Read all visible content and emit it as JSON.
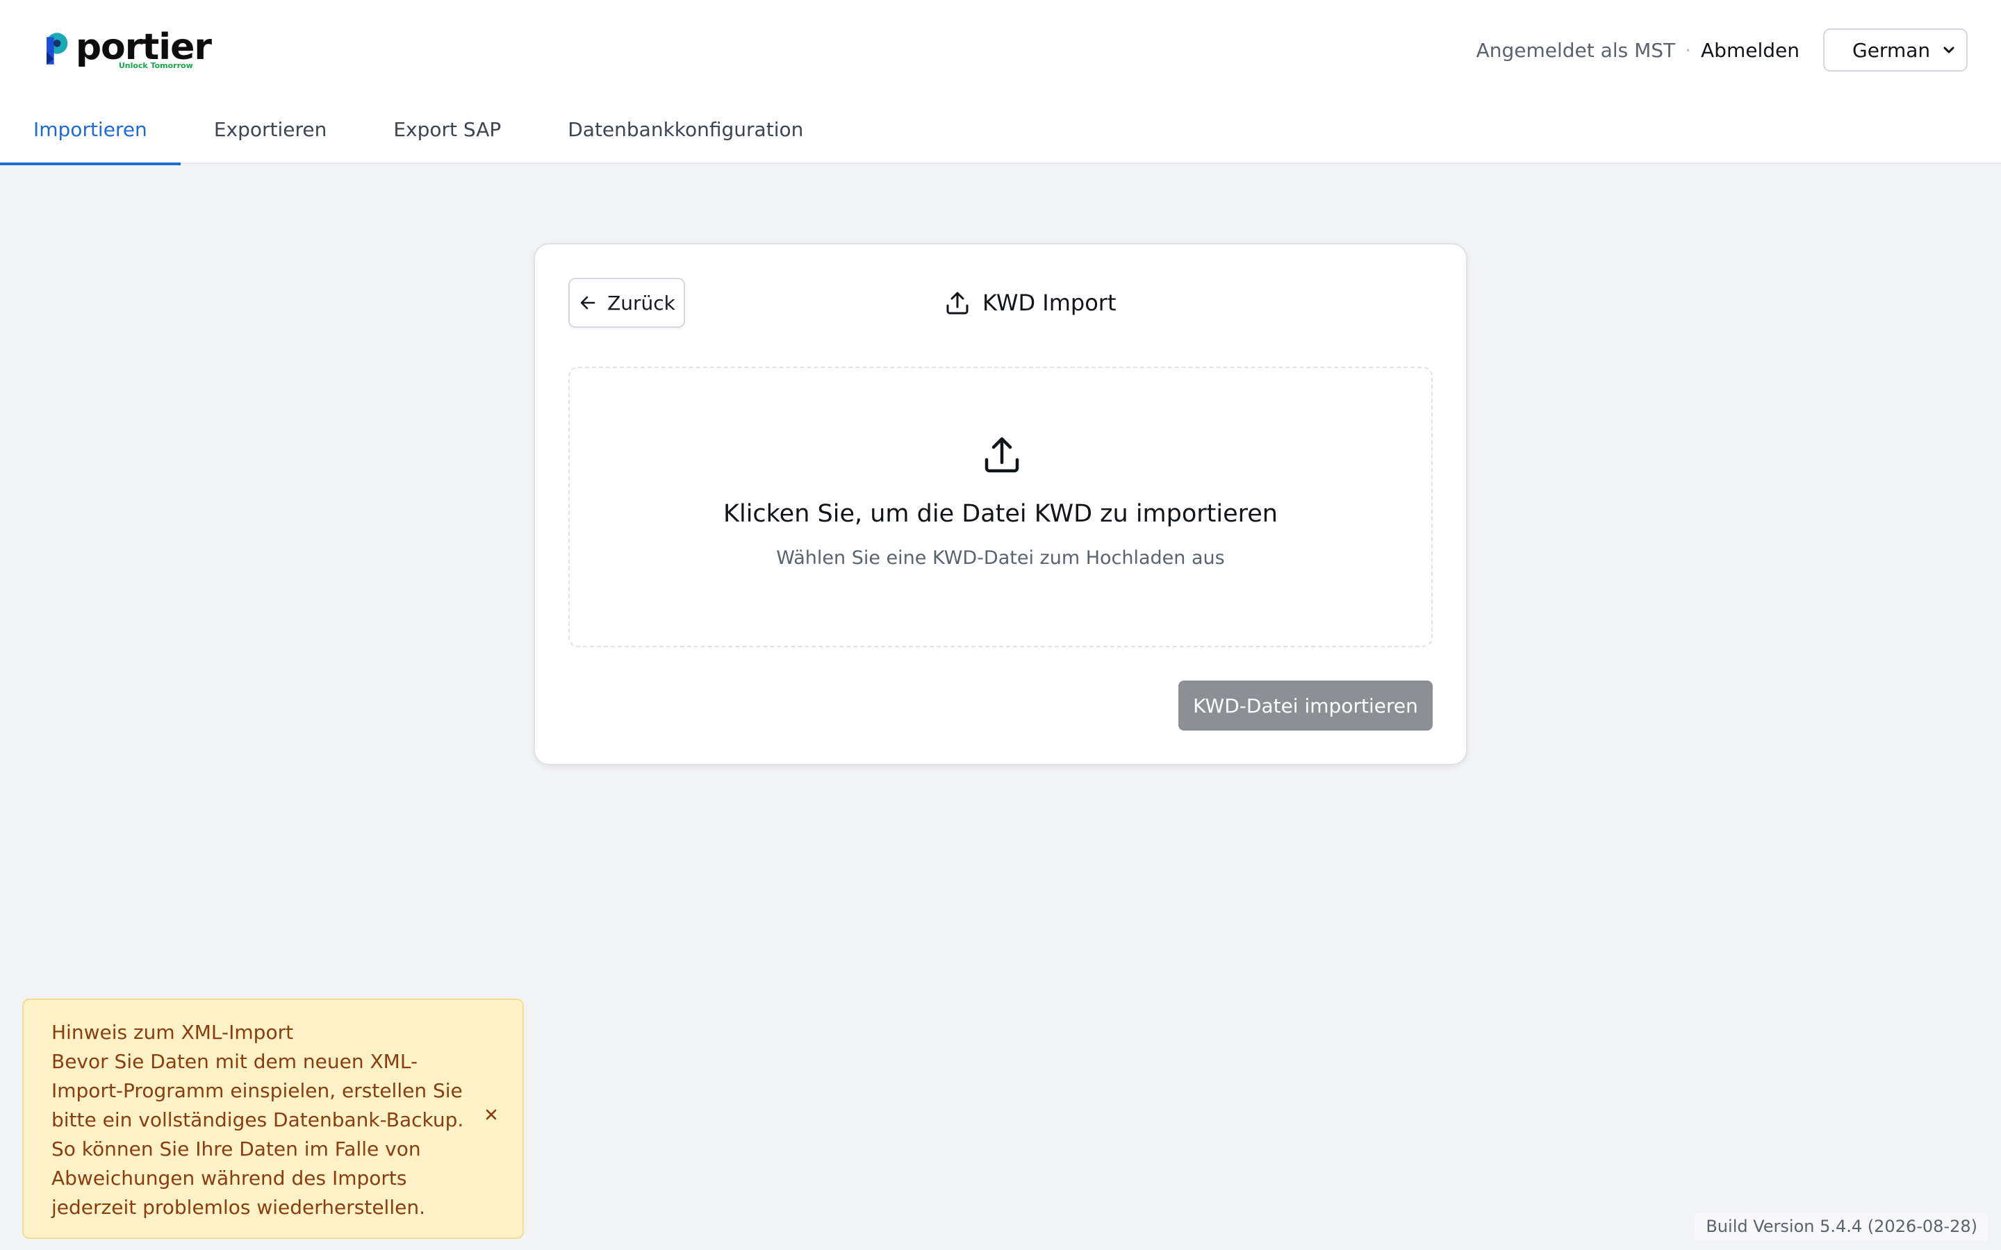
{
  "header": {
    "logo_text": "portier",
    "logo_tagline": "Unlock Tomorrow",
    "signed_in_text": "Angemeldet als MST",
    "separator": "·",
    "logout_label": "Abmelden",
    "language_selected": "German"
  },
  "nav": {
    "tabs": [
      {
        "label": "Importieren",
        "active": true
      },
      {
        "label": "Exportieren",
        "active": false
      },
      {
        "label": "Export SAP",
        "active": false
      },
      {
        "label": "Datenbankkonfiguration",
        "active": false
      }
    ]
  },
  "card": {
    "back_label": "Zurück",
    "title": "KWD Import",
    "dropzone_title": "Klicken Sie, um die Datei KWD zu importieren",
    "dropzone_subtitle": "Wählen Sie eine KWD-Datei zum Hochladen aus",
    "import_button_label": "KWD-Datei importieren"
  },
  "notice": {
    "title": "Hinweis zum XML-Import",
    "body": "Bevor Sie Daten mit dem neuen XML-Import-Programm einspielen, erstellen Sie bitte ein vollständiges Datenbank-Backup. So können Sie Ihre Daten im Falle von Abweichungen während des Imports jederzeit problemlos wiederherstellen."
  },
  "footer": {
    "build_version": "Build Version 5.4.4 (2026-08-28)"
  },
  "colors": {
    "accent": "#1f6bd6",
    "background": "#f2f3f5",
    "notice_background": "#fdf1c7",
    "notice_text": "#8a3d0e",
    "disabled_button": "#8c8f96"
  }
}
